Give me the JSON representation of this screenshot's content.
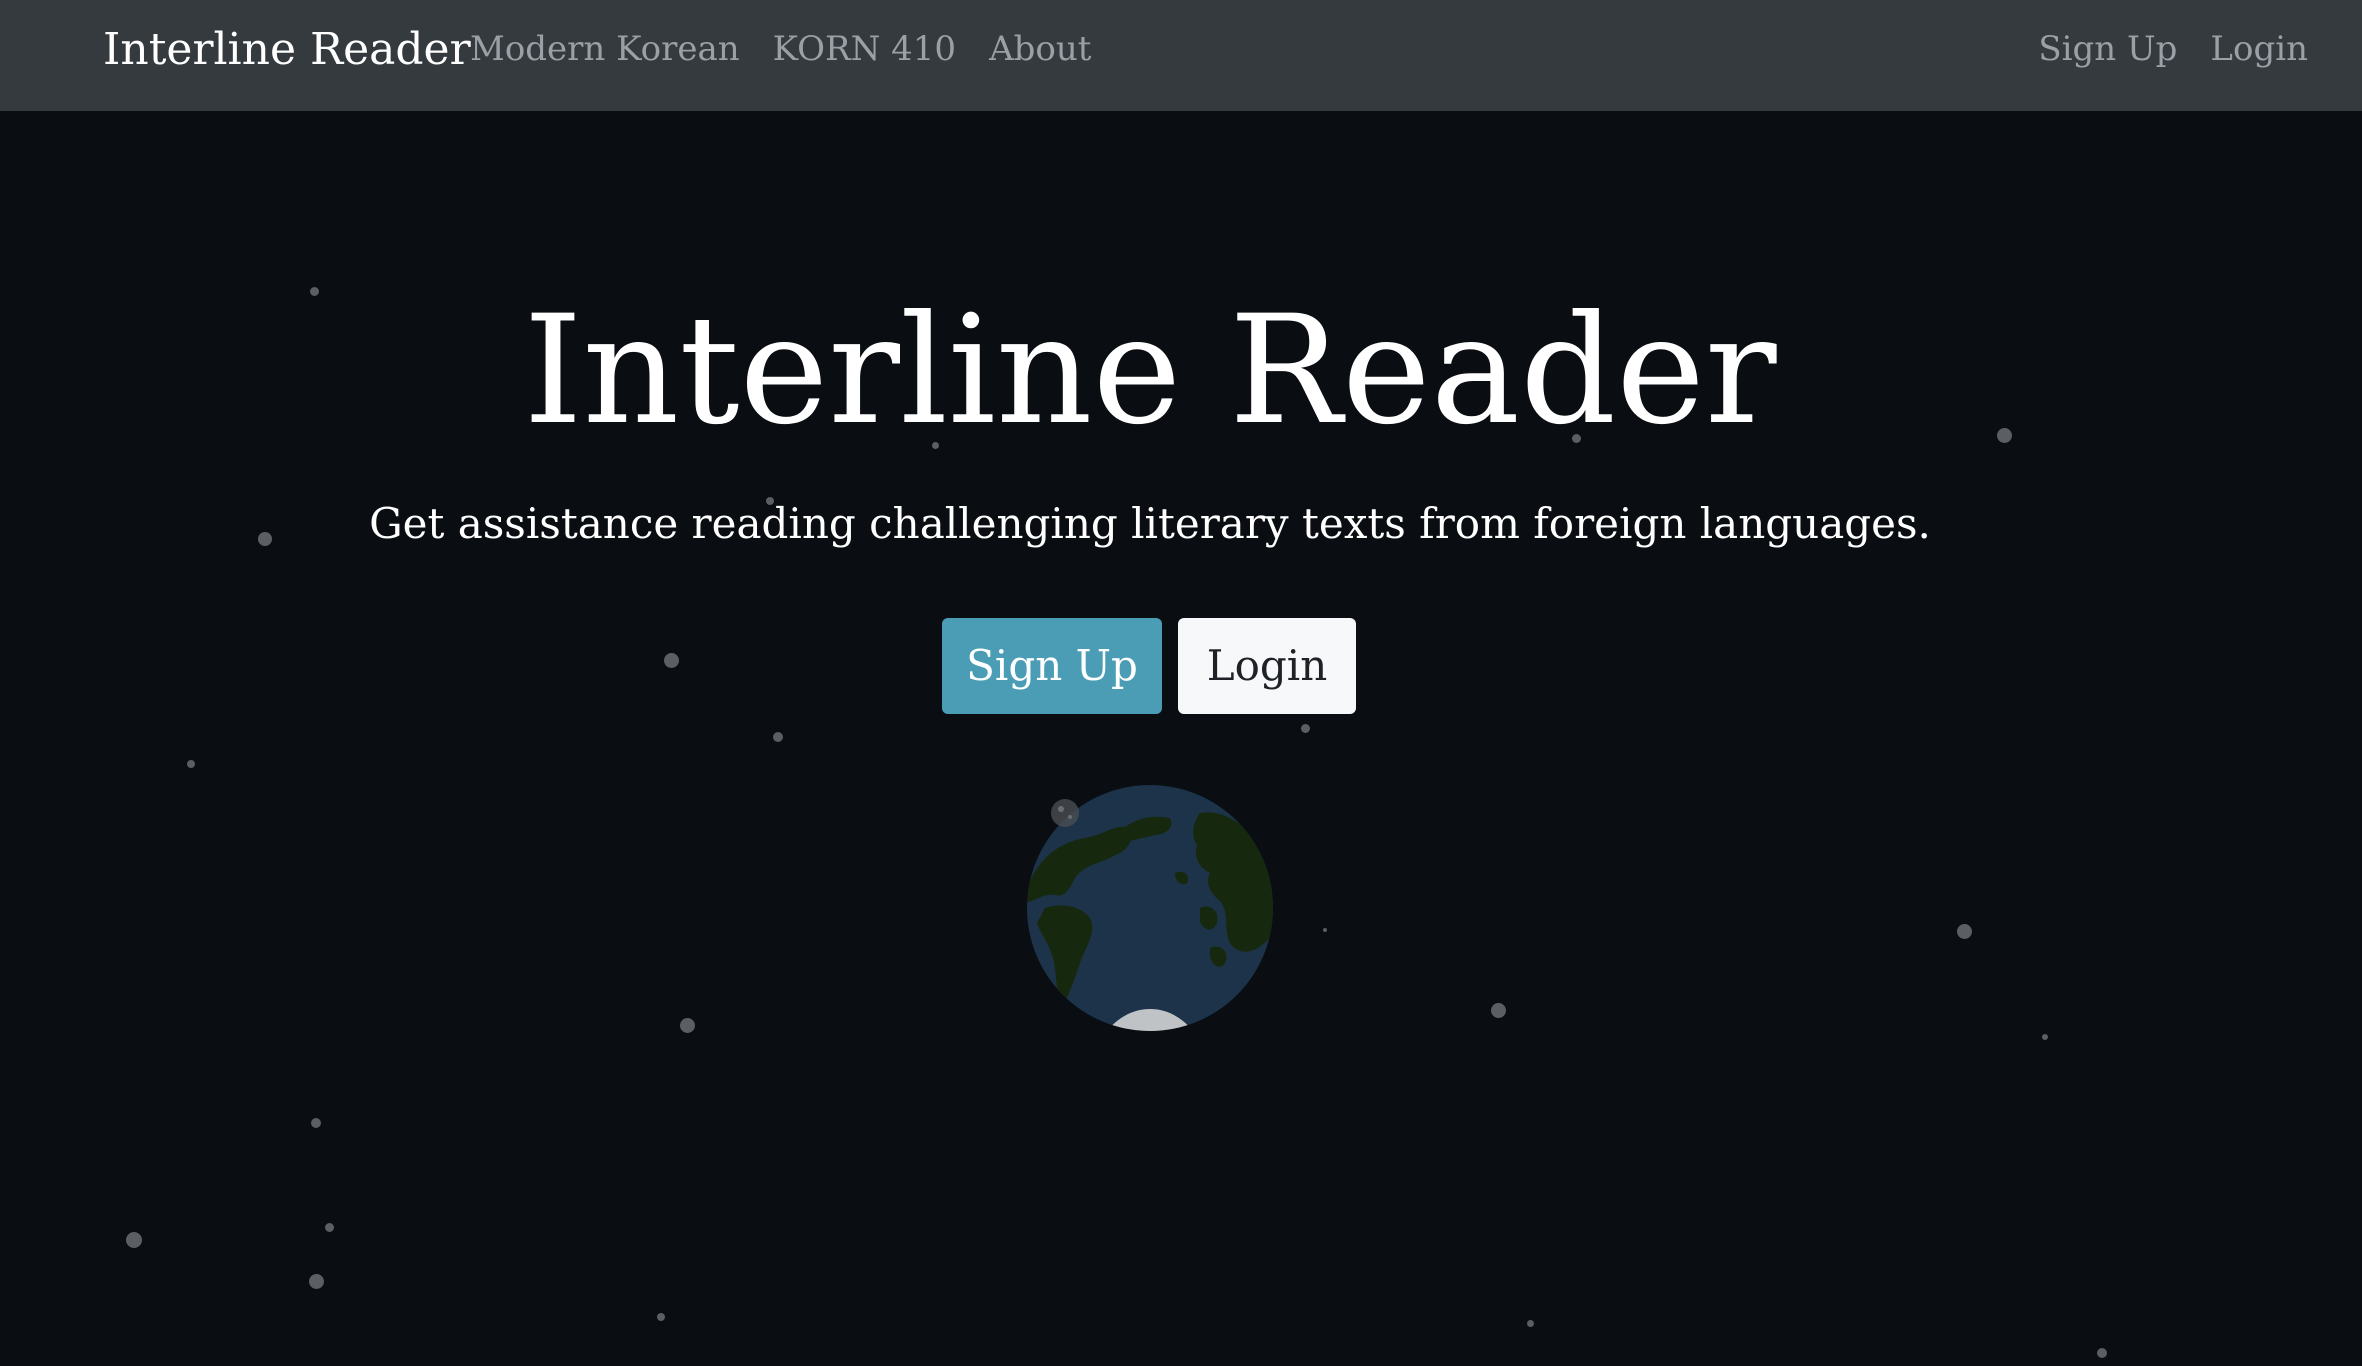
{
  "navbar": {
    "brand": "Interline Reader",
    "links": [
      {
        "label": "Modern Korean"
      },
      {
        "label": "KORN 410"
      },
      {
        "label": "About"
      }
    ],
    "right_links": [
      {
        "label": "Sign Up"
      },
      {
        "label": "Login"
      }
    ]
  },
  "hero": {
    "title": "Interline Reader",
    "subtitle": "Get assistance reading challenging literary texts from foreign languages.",
    "signup_label": "Sign Up",
    "login_label": "Login"
  },
  "colors": {
    "navbar_bg": "#353a3f",
    "hero_bg": "#0a0e13",
    "primary": "#4a9db5",
    "light_button": "#f7f8f9",
    "nav_link": "#9aa0a6"
  },
  "icons": {
    "globe": "earth-globe-icon",
    "stars": "star-dot-icon"
  }
}
